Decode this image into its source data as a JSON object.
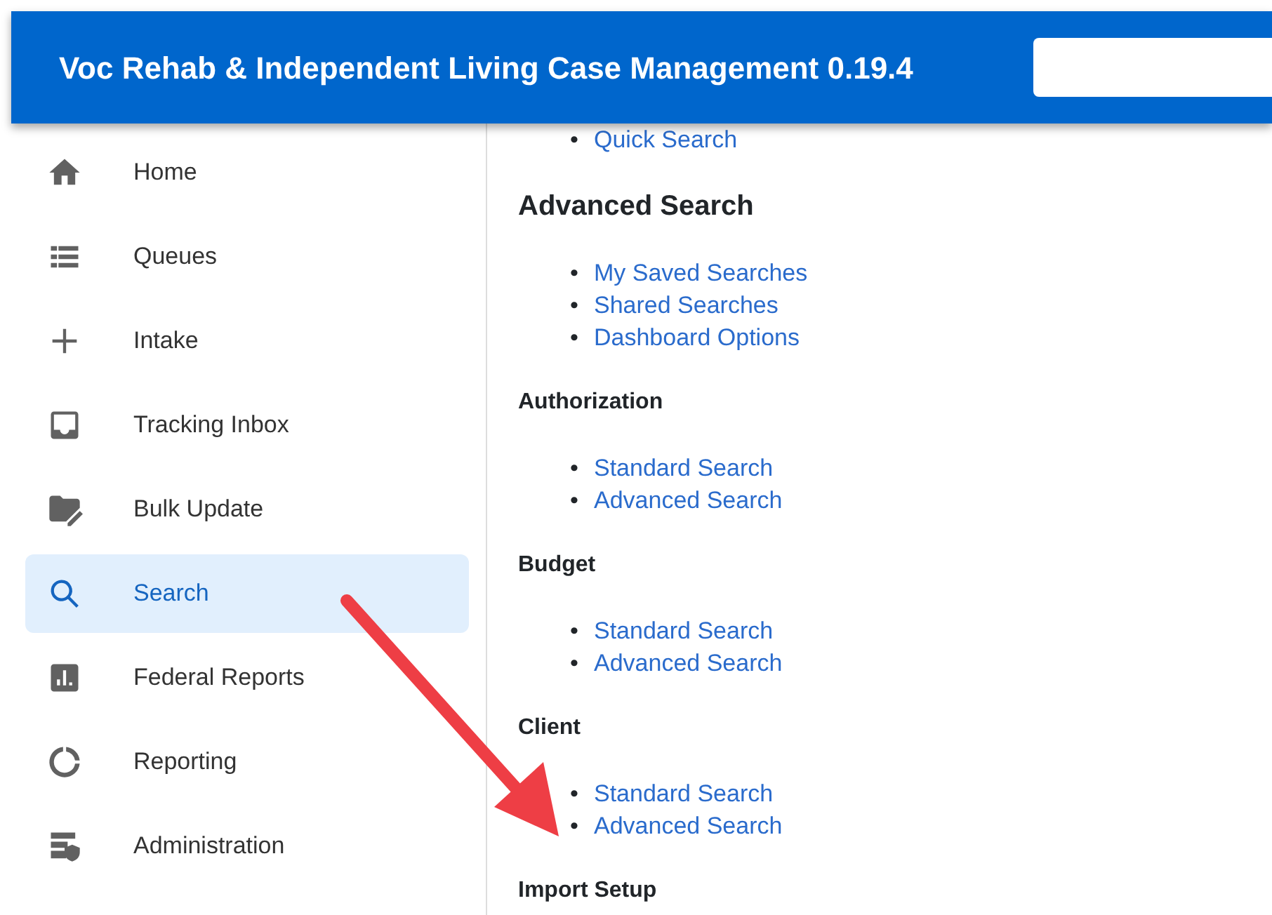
{
  "header": {
    "title": "Voc Rehab & Independent Living Case Management 0.19.4"
  },
  "sidebar": {
    "items": [
      {
        "label": "Home",
        "selected": false
      },
      {
        "label": "Queues",
        "selected": false
      },
      {
        "label": "Intake",
        "selected": false
      },
      {
        "label": "Tracking Inbox",
        "selected": false
      },
      {
        "label": "Bulk Update",
        "selected": false
      },
      {
        "label": "Search",
        "selected": true
      },
      {
        "label": "Federal Reports",
        "selected": false
      },
      {
        "label": "Reporting",
        "selected": false
      },
      {
        "label": "Administration",
        "selected": false
      }
    ]
  },
  "content": {
    "sections": [
      {
        "kind": "plain",
        "links": [
          {
            "marker": "•",
            "label": "Quick Search"
          }
        ]
      },
      {
        "kind": "major",
        "heading": "Advanced Search",
        "links": [
          {
            "marker": "•",
            "label": "My Saved Searches"
          },
          {
            "marker": "•",
            "label": "Shared Searches"
          },
          {
            "marker": "•",
            "label": "Dashboard Options"
          }
        ]
      },
      {
        "kind": "minor",
        "heading": "Authorization",
        "links": [
          {
            "marker": "•",
            "label": "Standard Search"
          },
          {
            "marker": "•",
            "label": "Advanced Search"
          }
        ]
      },
      {
        "kind": "minor",
        "heading": "Budget",
        "links": [
          {
            "marker": "•",
            "label": "Standard Search"
          },
          {
            "marker": "•",
            "label": "Advanced Search"
          }
        ]
      },
      {
        "kind": "minor",
        "heading": "Client",
        "links": [
          {
            "marker": "•",
            "label": "Standard Search"
          },
          {
            "marker": "•",
            "label": "Advanced Search"
          }
        ]
      },
      {
        "kind": "minor",
        "heading": "Import Setup"
      }
    ]
  }
}
